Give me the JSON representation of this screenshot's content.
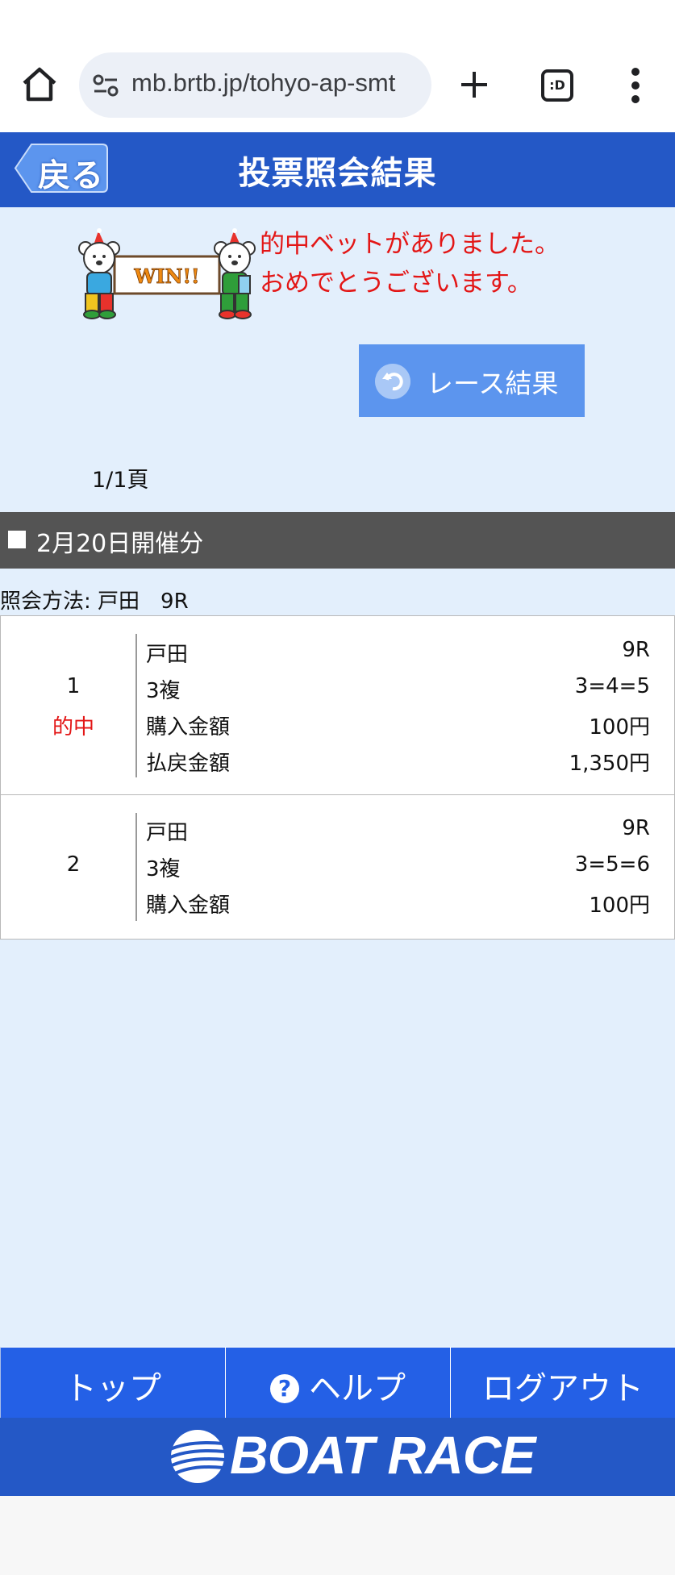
{
  "browser": {
    "url": "mb.brtb.jp/tohyo-ap-smt",
    "tabs_label": ":D"
  },
  "header": {
    "back_label": "戻る",
    "title": "投票照会結果"
  },
  "win_banner": {
    "line1": "的中ベットがありました。",
    "line2": "おめでとうございます。",
    "image_text": "WIN!!"
  },
  "race_result_button": {
    "label": "レース結果"
  },
  "page_indicator": "1/1頁",
  "date_header": "2月20日開催分",
  "query_method": "照会方法: 戸田　9R",
  "bets": [
    {
      "number": "1",
      "hit_label": "的中",
      "venue": "戸田",
      "race": "9R",
      "bet_type": "3複",
      "combination": "3=4=5",
      "purchase_label": "購入金額",
      "purchase_amount": "100円",
      "payout_label": "払戻金額",
      "payout_amount": "1,350円"
    },
    {
      "number": "2",
      "venue": "戸田",
      "race": "9R",
      "bet_type": "3複",
      "combination": "3=5=6",
      "purchase_label": "購入金額",
      "purchase_amount": "100円"
    }
  ],
  "bottom_nav": {
    "top_label": "トップ",
    "help_label": "ヘルプ",
    "logout_label": "ログアウト"
  },
  "footer": {
    "logo_text": "BOAT RACE"
  },
  "colors": {
    "header_blue": "#2458c6",
    "nav_blue": "#2460e6",
    "content_bg": "#e3effc",
    "hit_red": "#e31616",
    "button_blue": "#5c95ee"
  }
}
